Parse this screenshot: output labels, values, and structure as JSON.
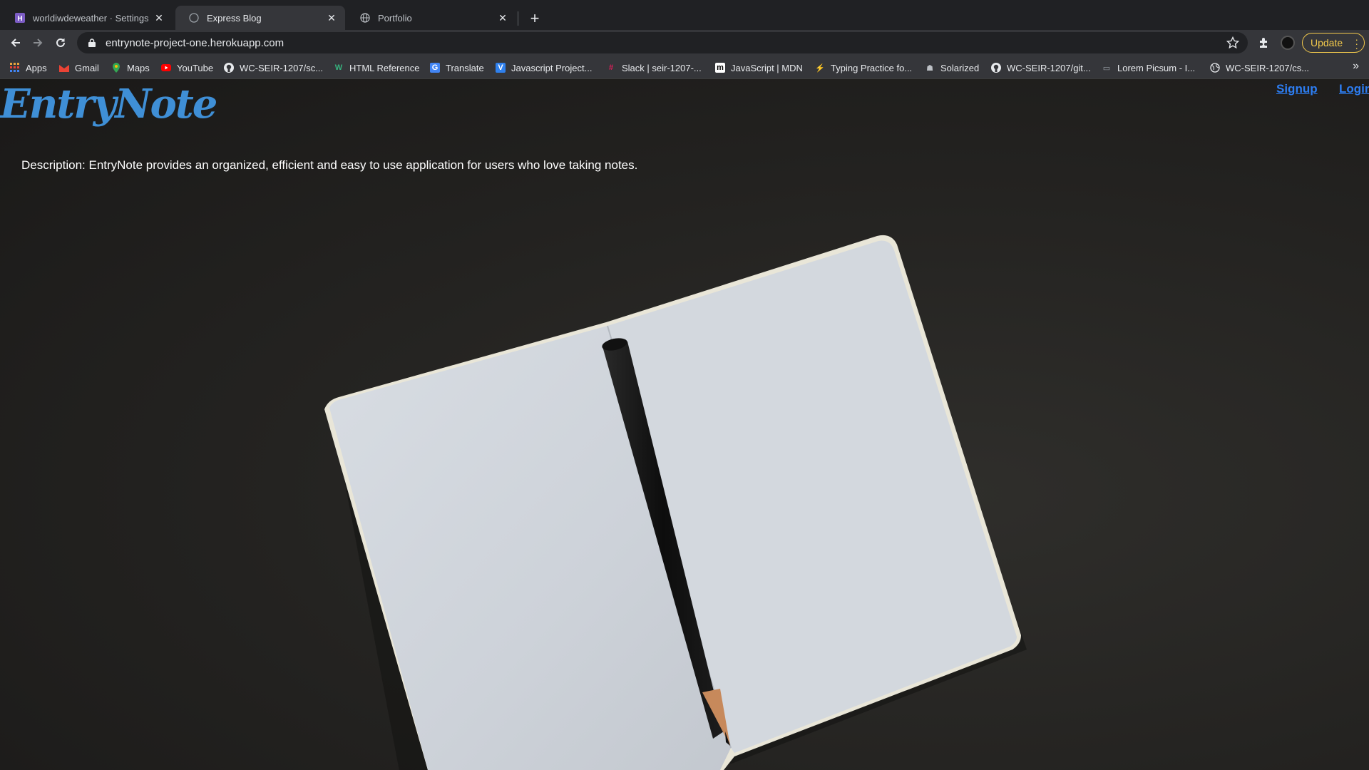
{
  "browser": {
    "tabs": [
      {
        "title": "worldiwdeweather · Settings | H",
        "favicon": "heroku-icon",
        "active": false
      },
      {
        "title": "Express Blog",
        "favicon": "globe-icon",
        "active": true
      },
      {
        "title": "Portfolio",
        "favicon": "globe-icon",
        "active": false
      }
    ],
    "close_glyph": "✕",
    "new_tab_glyph": "+",
    "url": "entrynote-project-one.herokuapp.com",
    "update_label": "Update",
    "update_color": "#f2c94c"
  },
  "bookmarks": {
    "items": [
      {
        "label": "Apps",
        "icon": "apps-grid-icon"
      },
      {
        "label": "Gmail",
        "icon": "gmail-icon"
      },
      {
        "label": "Maps",
        "icon": "maps-icon"
      },
      {
        "label": "YouTube",
        "icon": "youtube-icon"
      },
      {
        "label": "WC-SEIR-1207/sc...",
        "icon": "github-icon"
      },
      {
        "label": "HTML Reference",
        "icon": "w-icon"
      },
      {
        "label": "Translate",
        "icon": "translate-icon"
      },
      {
        "label": "Javascript Project...",
        "icon": "vue-icon"
      },
      {
        "label": "Slack | seir-1207-...",
        "icon": "slack-icon"
      },
      {
        "label": "JavaScript | MDN",
        "icon": "mdn-icon"
      },
      {
        "label": "Typing Practice fo...",
        "icon": "bolt-icon"
      },
      {
        "label": "Solarized",
        "icon": "solarized-icon"
      },
      {
        "label": "WC-SEIR-1207/git...",
        "icon": "github-icon"
      },
      {
        "label": "Lorem Picsum - I...",
        "icon": "picsum-icon"
      },
      {
        "label": "WC-SEIR-1207/cs...",
        "icon": "globe-icon"
      }
    ],
    "more_glyph": "»"
  },
  "page": {
    "logo": "EntryNote",
    "nav": {
      "signup": "Signup",
      "login": "Login"
    },
    "description": "Description: EntryNote provides an organized, efficient and easy to use application for users who love taking notes.",
    "link_color": "#2d7ef3",
    "logo_color": "#3f8fd6"
  }
}
